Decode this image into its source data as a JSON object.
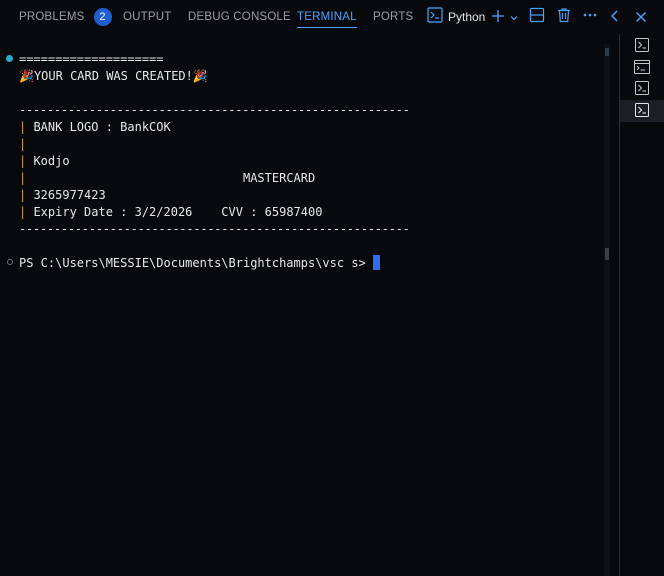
{
  "tabs": [
    {
      "label": "PROBLEMS",
      "badge": "2"
    },
    {
      "label": "OUTPUT"
    },
    {
      "label": "DEBUG CONSOLE"
    },
    {
      "label": "TERMINAL",
      "active": true
    },
    {
      "label": "PORTS"
    }
  ],
  "toolbar": {
    "shell_label": "Python",
    "icons": [
      "terminal-icon",
      "plus-icon",
      "chevron-down-icon",
      "split-icon",
      "trash-icon",
      "more-icon",
      "chevron-left-icon",
      "close-icon"
    ]
  },
  "terminal": {
    "lines": {
      "equals": "====================",
      "created": "🎉YOUR CARD WAS CREATED!🎉",
      "dashes_top": "--------------------------------------------------------",
      "bank_logo": " BANK LOGO : BankCOK",
      "holder": " Kodjo",
      "network": "                              MASTERCARD",
      "number": " 3265977423",
      "expiry": " Expiry Date : 3/2/2026    CVV : 65987400",
      "dashes_bottom": "--------------------------------------------------------",
      "prompt": "PS C:\\Users\\MESSIE\\Documents\\Brightchamps\\vsc s>"
    }
  },
  "side_list": {
    "items": [
      "terminal-instance-icon",
      "console-window-icon",
      "terminal-instance-icon",
      "terminal-instance-icon"
    ],
    "active_index": 3
  },
  "colors": {
    "accent": "#4aa3ff",
    "badge": "#1f5fd1",
    "background": "#07090c",
    "bar": "#c8a24a",
    "cursor": "#2f6df0"
  }
}
